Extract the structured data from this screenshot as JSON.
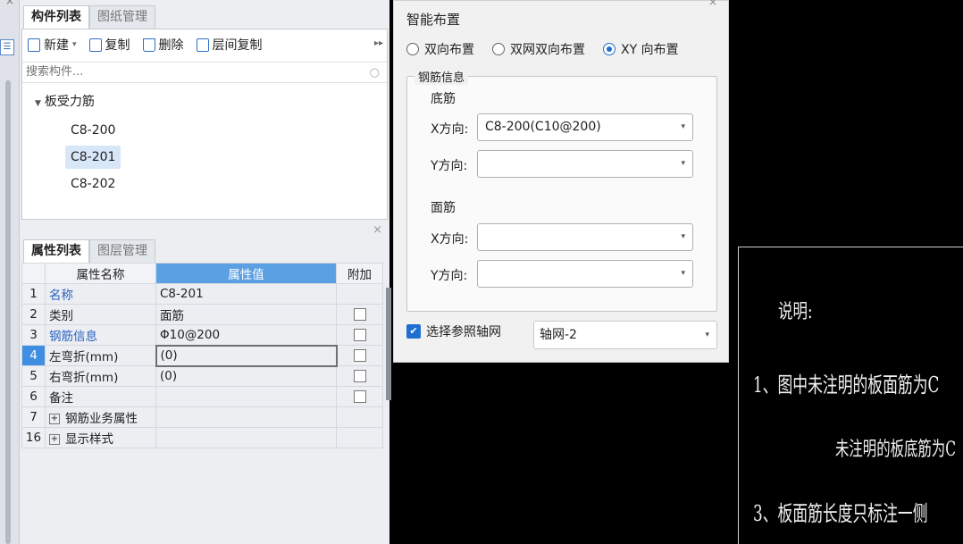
{
  "component_panel": {
    "tabs": [
      "构件列表",
      "图纸管理"
    ],
    "toolbar": {
      "new_label": "新建",
      "copy_label": "复制",
      "delete_label": "删除",
      "floor_copy_label": "层间复制"
    },
    "search_placeholder": "搜索构件...",
    "tree": {
      "group": "板受力筋",
      "items": [
        "C8-200",
        "C8-201",
        "C8-202"
      ],
      "selected": "C8-201"
    }
  },
  "property_panel": {
    "tabs": [
      "属性列表",
      "图层管理"
    ],
    "headers": [
      "属性名称",
      "属性值",
      "附加"
    ],
    "rows": [
      {
        "num": "1",
        "name": "名称",
        "value": "C8-201"
      },
      {
        "num": "2",
        "name": "类别",
        "value": "面筋"
      },
      {
        "num": "3",
        "name": "钢筋信息",
        "value": "Φ10@200"
      },
      {
        "num": "4",
        "name": "左弯折(mm)",
        "value": "(0)"
      },
      {
        "num": "5",
        "name": "右弯折(mm)",
        "value": "(0)"
      },
      {
        "num": "6",
        "name": "备注",
        "value": ""
      },
      {
        "num": "7",
        "name": "钢筋业务属性",
        "value": ""
      },
      {
        "num": "16",
        "name": "显示样式",
        "value": ""
      }
    ]
  },
  "dialog": {
    "title": "智能布置",
    "radios": [
      "双向布置",
      "双网双向布置",
      "XY 向布置"
    ],
    "selected_radio": "XY 向布置",
    "group_title": "钢筋信息",
    "bottom_label": "底筋",
    "top_label": "面筋",
    "x_label": "X方向:",
    "y_label": "Y方向:",
    "bottom_x_value": "C8-200(C10@200)",
    "bottom_y_value": "",
    "top_x_value": "",
    "top_y_value": "",
    "reference_grid_label": "选择参照轴网",
    "reference_grid_value": "轴网-2"
  },
  "cad_notes": {
    "heading": "说明:",
    "line1": "1、图中未注明的板面筋为C",
    "line2": "未注明的板底筋为C",
    "line3": "3、板面筋长度只标注一侧"
  },
  "colors": {
    "accent": "#2f6fc6",
    "selection": "#3f8ee1",
    "header": "#5ca0e4"
  }
}
